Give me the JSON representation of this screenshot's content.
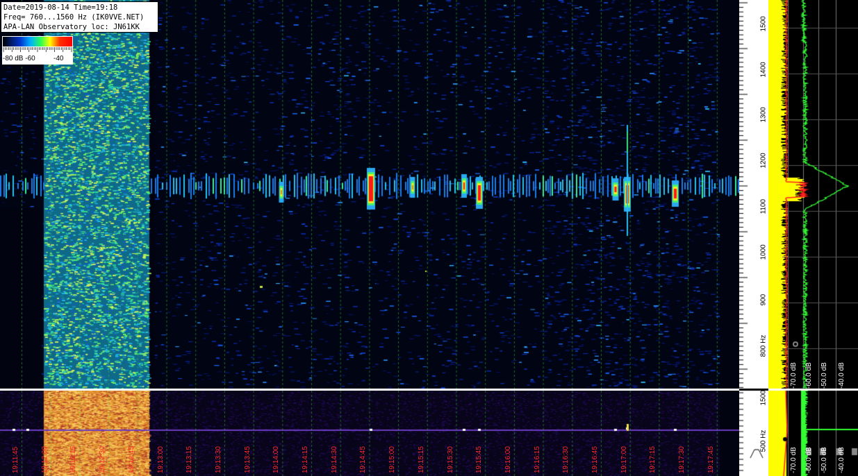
{
  "info": {
    "line1": "Date=2019-08-14 Time=19:18",
    "line2": "Freq= 760...1560 Hz (IK0VVE.NET)",
    "line3": "APA-LAN Observatory loc: JN61KK"
  },
  "legend": {
    "label_a": "-80 dB -60",
    "label_b": "-40"
  },
  "freq_axis": {
    "ticks": [
      "1500",
      "1400",
      "1300",
      "1200",
      "1100",
      "1000",
      "900",
      "800 Hz"
    ],
    "lower_ticks": [
      "1500",
      "500 Hz"
    ]
  },
  "time_axis": {
    "labels": [
      "19:11:45",
      "19:12:00",
      "19:12:15",
      "19:12:30",
      "19:12:45",
      "19:13:00",
      "19:13:15",
      "19:13:30",
      "19:13:45",
      "19:14:00",
      "19:14:15",
      "19:14:30",
      "19:14:45",
      "19:15:00",
      "19:15:15",
      "19:15:30",
      "19:15:45",
      "19:16:00",
      "19:16:15",
      "19:16:30",
      "19:16:45",
      "19:17:00",
      "19:17:15",
      "19:17:30",
      "19:17:45"
    ]
  },
  "spectrum_axis": {
    "upper": [
      "-70.0 dB",
      "-60.0 dB",
      "-50.0 dB",
      "-40.0 dB"
    ],
    "lower": [
      "-70.0 dB",
      "-60.0 dB",
      "-50.0 dB",
      "-40.0 dB"
    ]
  },
  "colors": {
    "noise": "#0a1d6b",
    "meteor": "#ff1a1a",
    "spectrum_peak": "#ffff00",
    "spectrum_avg": "#33ff33",
    "time_label": "#ff2a2a"
  }
}
